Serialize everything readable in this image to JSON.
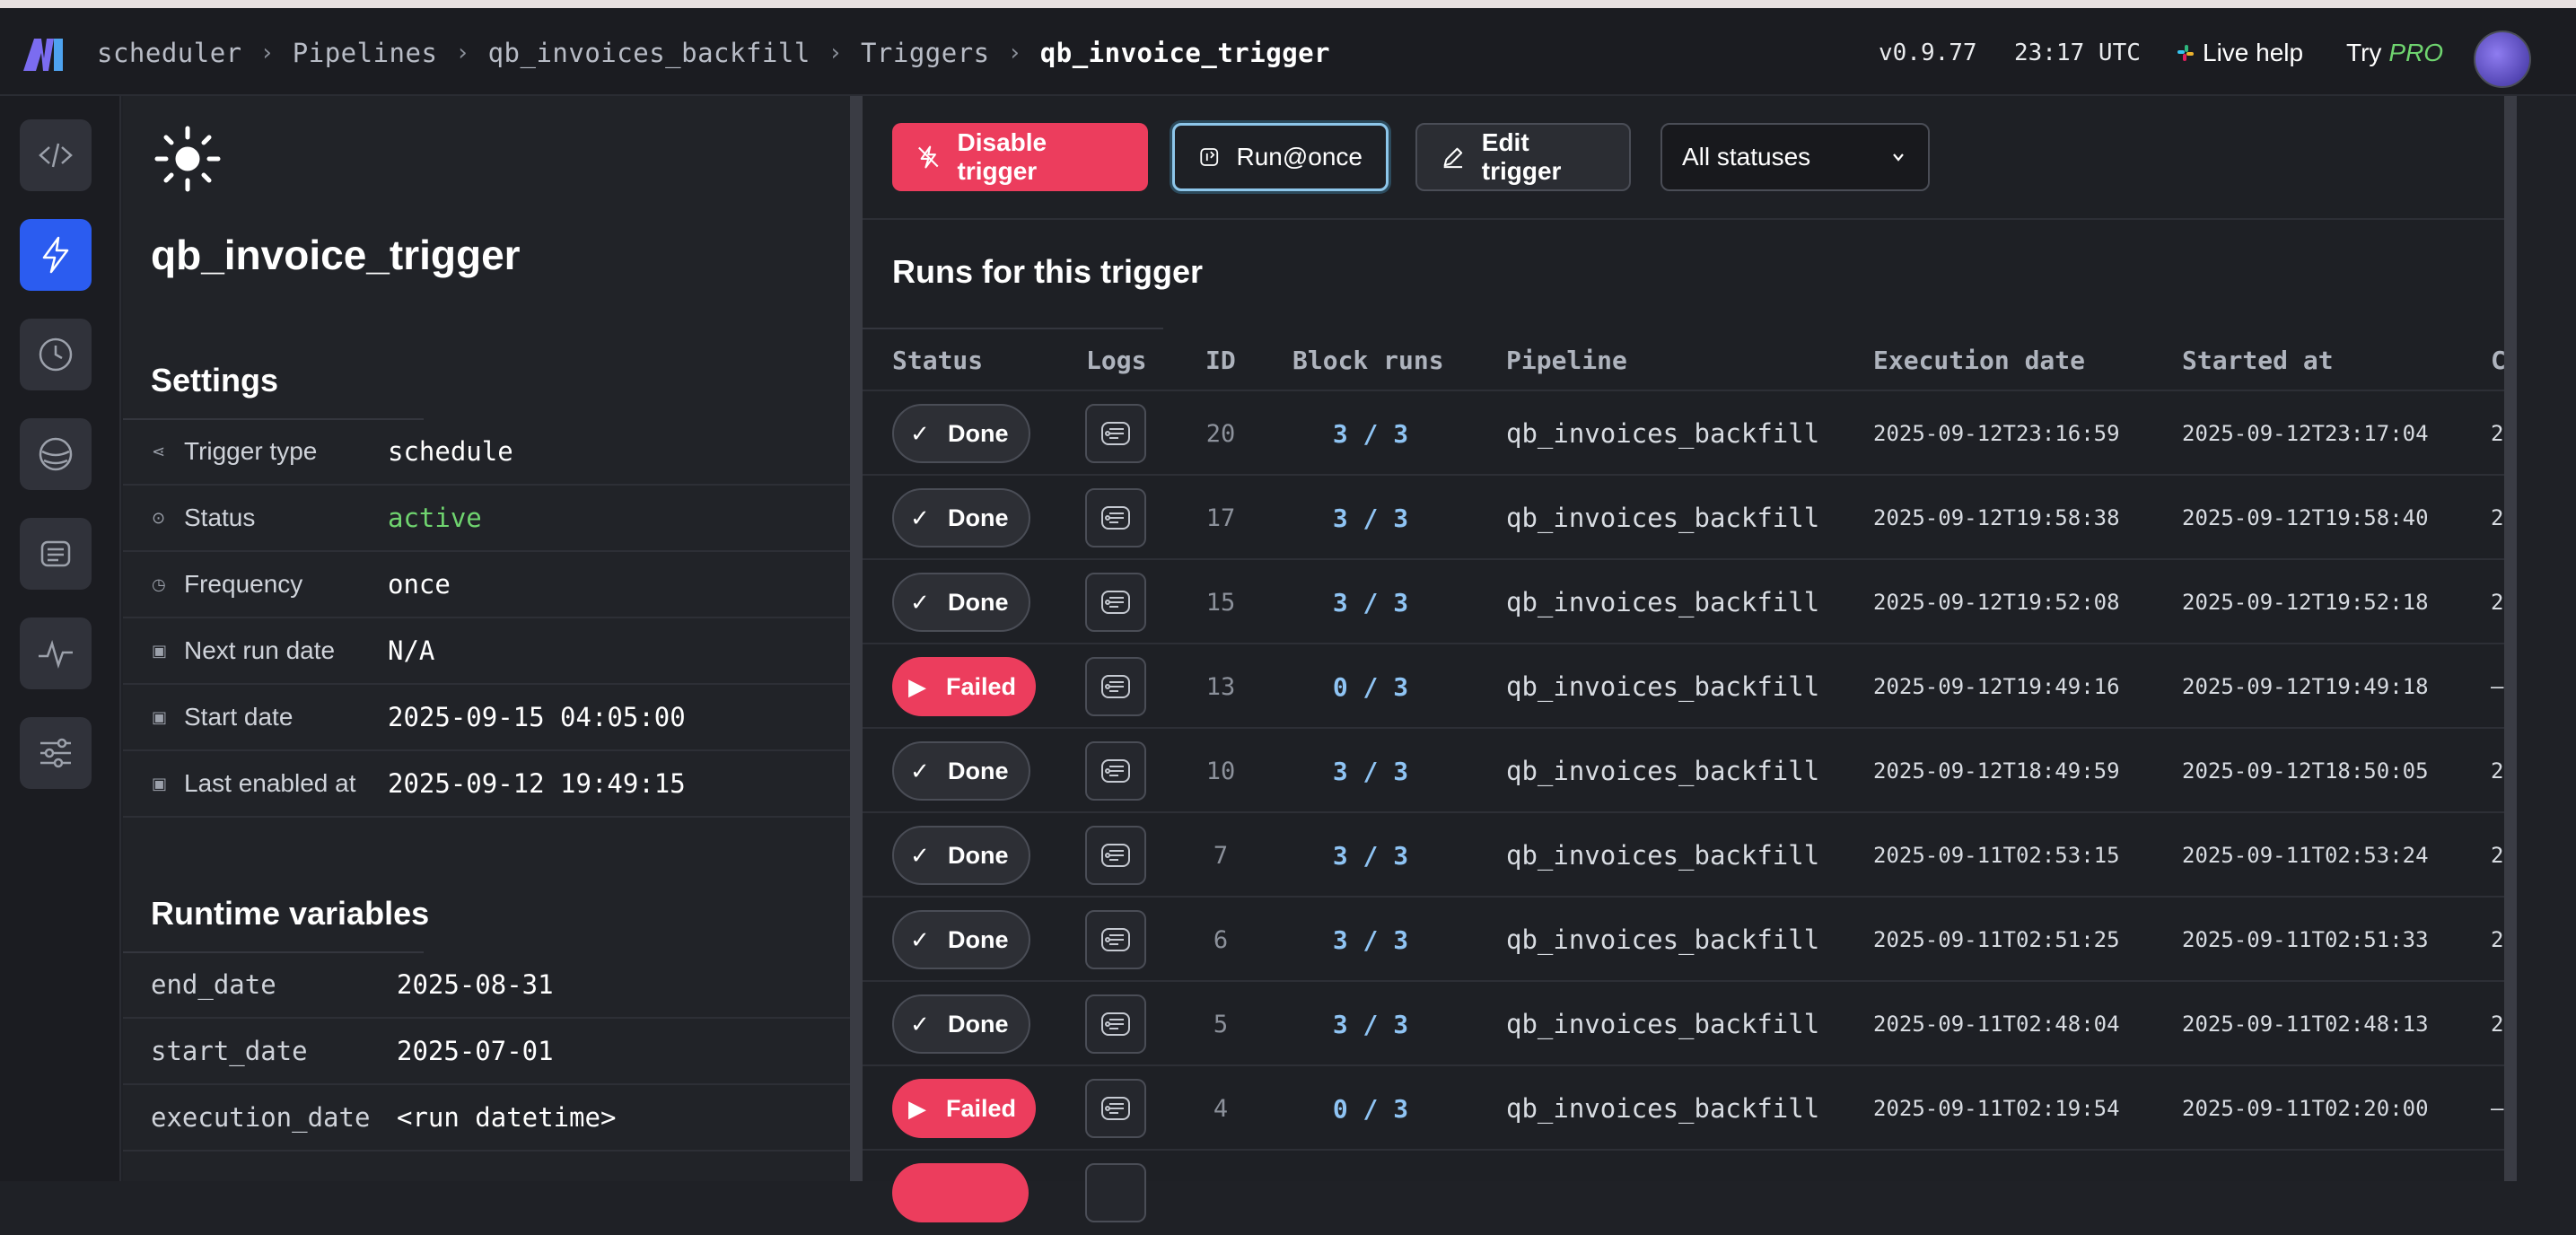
{
  "breadcrumb": [
    "scheduler",
    "Pipelines",
    "qb_invoices_backfill",
    "Triggers",
    "qb_invoice_trigger"
  ],
  "header": {
    "version": "v0.9.77",
    "time": "23:17 UTC",
    "live_help": "Live help",
    "try_label": "Try",
    "pro_label": "PRO"
  },
  "rail_icons": [
    "code-icon",
    "lightning-icon",
    "clock-icon",
    "globe-icon",
    "terminal-icon",
    "pulse-icon",
    "sliders-icon"
  ],
  "trigger": {
    "name": "qb_invoice_trigger"
  },
  "settings": {
    "title": "Settings",
    "rows": [
      {
        "label": "Trigger type",
        "value": "schedule"
      },
      {
        "label": "Status",
        "value": "active"
      },
      {
        "label": "Frequency",
        "value": "once"
      },
      {
        "label": "Next run date",
        "value": "N/A"
      },
      {
        "label": "Start date",
        "value": "2025-09-15 04:05:00"
      },
      {
        "label": "Last enabled at",
        "value": "2025-09-12 19:49:15"
      }
    ]
  },
  "runtime": {
    "title": "Runtime variables",
    "rows": [
      {
        "key": "end_date",
        "value": "2025-08-31"
      },
      {
        "key": "start_date",
        "value": "2025-07-01"
      },
      {
        "key": "execution_date",
        "value": "<run datetime>"
      }
    ]
  },
  "toolbar": {
    "disable": "Disable trigger",
    "run_once": "Run@once",
    "edit": "Edit trigger",
    "status_filter": "All statuses"
  },
  "runs": {
    "title": "Runs for this trigger",
    "columns": [
      "Status",
      "Logs",
      "ID",
      "Block runs",
      "Pipeline",
      "Execution date",
      "Started at",
      "C"
    ],
    "rows": [
      {
        "status": "Done",
        "id": "20",
        "blocks": "3 / 3",
        "pipeline": "qb_invoices_backfill",
        "exec": "2025-09-12T23:16:59",
        "started": "2025-09-12T23:17:04",
        "cut": "2"
      },
      {
        "status": "Done",
        "id": "17",
        "blocks": "3 / 3",
        "pipeline": "qb_invoices_backfill",
        "exec": "2025-09-12T19:58:38",
        "started": "2025-09-12T19:58:40",
        "cut": "2"
      },
      {
        "status": "Done",
        "id": "15",
        "blocks": "3 / 3",
        "pipeline": "qb_invoices_backfill",
        "exec": "2025-09-12T19:52:08",
        "started": "2025-09-12T19:52:18",
        "cut": "2"
      },
      {
        "status": "Failed",
        "id": "13",
        "blocks": "0 / 3",
        "pipeline": "qb_invoices_backfill",
        "exec": "2025-09-12T19:49:16",
        "started": "2025-09-12T19:49:18",
        "cut": "–"
      },
      {
        "status": "Done",
        "id": "10",
        "blocks": "3 / 3",
        "pipeline": "qb_invoices_backfill",
        "exec": "2025-09-12T18:49:59",
        "started": "2025-09-12T18:50:05",
        "cut": "2"
      },
      {
        "status": "Done",
        "id": "7",
        "blocks": "3 / 3",
        "pipeline": "qb_invoices_backfill",
        "exec": "2025-09-11T02:53:15",
        "started": "2025-09-11T02:53:24",
        "cut": "2"
      },
      {
        "status": "Done",
        "id": "6",
        "blocks": "3 / 3",
        "pipeline": "qb_invoices_backfill",
        "exec": "2025-09-11T02:51:25",
        "started": "2025-09-11T02:51:33",
        "cut": "2"
      },
      {
        "status": "Done",
        "id": "5",
        "blocks": "3 / 3",
        "pipeline": "qb_invoices_backfill",
        "exec": "2025-09-11T02:48:04",
        "started": "2025-09-11T02:48:13",
        "cut": "2"
      },
      {
        "status": "Failed",
        "id": "4",
        "blocks": "0 / 3",
        "pipeline": "qb_invoices_backfill",
        "exec": "2025-09-11T02:19:54",
        "started": "2025-09-11T02:20:00",
        "cut": "–"
      }
    ]
  },
  "colors": {
    "accent": "#2b5cf0",
    "danger": "#ec3d5d",
    "success": "#6fd46f",
    "link": "#8fc4f4"
  }
}
